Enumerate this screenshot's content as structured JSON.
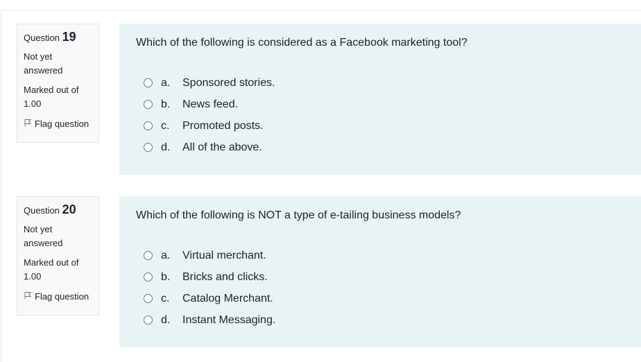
{
  "questions": [
    {
      "label": "Question",
      "number": "19",
      "state": "Not yet answered",
      "grade": "Marked out of 1.00",
      "flag": "Flag question",
      "text": "Which of the following is considered as a Facebook marketing tool?",
      "options": [
        {
          "letter": "a.",
          "text": "Sponsored stories."
        },
        {
          "letter": "b.",
          "text": "News feed."
        },
        {
          "letter": "c.",
          "text": "Promoted posts."
        },
        {
          "letter": "d.",
          "text": "All of the above."
        }
      ]
    },
    {
      "label": "Question",
      "number": "20",
      "state": "Not yet answered",
      "grade": "Marked out of 1.00",
      "flag": "Flag question",
      "text": "Which of the following is NOT a type of e-tailing business models?",
      "options": [
        {
          "letter": "a.",
          "text": "Virtual merchant."
        },
        {
          "letter": "b.",
          "text": "Bricks and clicks."
        },
        {
          "letter": "c.",
          "text": "Catalog Merchant."
        },
        {
          "letter": "d.",
          "text": "Instant Messaging."
        }
      ]
    }
  ],
  "colors": {
    "info_bg": "#f8f9fa",
    "content_bg": "#e7f3f5",
    "text": "#1d2125"
  },
  "icons": {
    "flag": "flag-icon",
    "radio": "radio-circle"
  }
}
